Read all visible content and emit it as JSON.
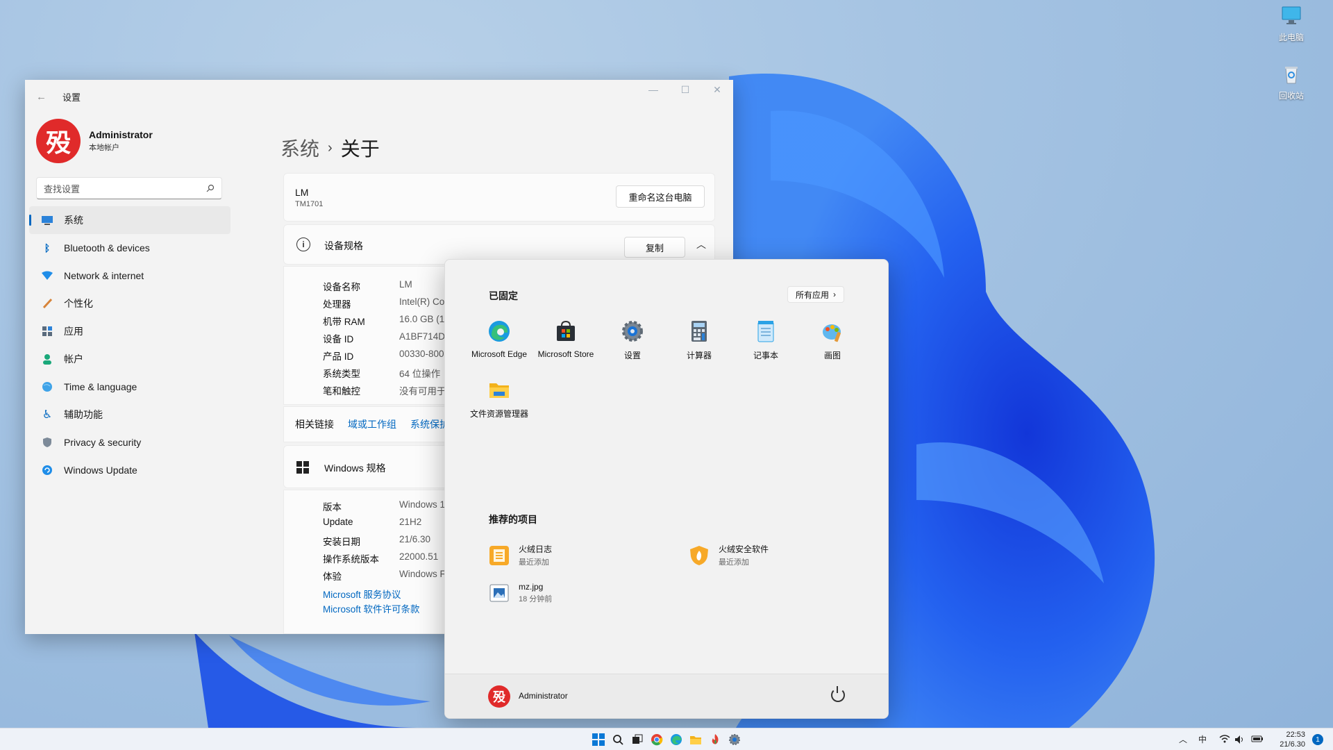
{
  "desktop": {
    "icons": [
      {
        "label": "此电脑",
        "icon": "monitor-icon"
      },
      {
        "label": "回收站",
        "icon": "recycle-bin-icon"
      }
    ]
  },
  "settings": {
    "title": "设置",
    "user": {
      "name": "Administrator",
      "type": "本地帐户",
      "avatar_char": "殁"
    },
    "search_placeholder": "查找设置",
    "nav": [
      {
        "label": "系统",
        "icon": "system-icon",
        "active": true
      },
      {
        "label": "Bluetooth & devices",
        "icon": "bluetooth-icon"
      },
      {
        "label": "Network & internet",
        "icon": "wifi-icon"
      },
      {
        "label": "个性化",
        "icon": "brush-icon"
      },
      {
        "label": "应用",
        "icon": "apps-icon"
      },
      {
        "label": "帐户",
        "icon": "person-icon"
      },
      {
        "label": "Time & language",
        "icon": "globe-icon"
      },
      {
        "label": "辅助功能",
        "icon": "accessibility-icon"
      },
      {
        "label": "Privacy & security",
        "icon": "shield-icon"
      },
      {
        "label": "Windows Update",
        "icon": "update-icon"
      }
    ],
    "breadcrumb": {
      "parent": "系统",
      "separator": "›",
      "current": "关于"
    },
    "pc": {
      "name": "LM",
      "model": "TM1701",
      "rename_label": "重命名这台电脑"
    },
    "device_spec": {
      "title": "设备规格",
      "copy_label": "复制",
      "rows": [
        {
          "label": "设备名称",
          "value": "LM"
        },
        {
          "label": "处理器",
          "value": "Intel(R) Co"
        },
        {
          "label": "机带 RAM",
          "value": "16.0 GB (15"
        },
        {
          "label": "设备 ID",
          "value": "A1BF714D-"
        },
        {
          "label": "产品 ID",
          "value": "00330-800"
        },
        {
          "label": "系统类型",
          "value": "64 位操作"
        },
        {
          "label": "笔和触控",
          "value": "没有可用于"
        }
      ]
    },
    "related": {
      "label": "相关链接",
      "links": [
        "域或工作组",
        "系统保护"
      ]
    },
    "windows_spec": {
      "title": "Windows 规格",
      "rows": [
        {
          "label": "版本",
          "value": "Windows 1"
        },
        {
          "label": "Update",
          "value": "21H2"
        },
        {
          "label": "安装日期",
          "value": "21/6.30"
        },
        {
          "label": "操作系统版本",
          "value": "22000.51"
        },
        {
          "label": "体验",
          "value": "Windows F"
        }
      ],
      "links": [
        "Microsoft 服务协议",
        "Microsoft 软件许可条款"
      ]
    }
  },
  "start_menu": {
    "pinned_title": "已固定",
    "all_apps_label": "所有应用",
    "pinned": [
      {
        "label": "Microsoft Edge",
        "icon": "edge-icon"
      },
      {
        "label": "Microsoft Store",
        "icon": "store-icon"
      },
      {
        "label": "设置",
        "icon": "settings-gear-icon"
      },
      {
        "label": "计算器",
        "icon": "calculator-icon"
      },
      {
        "label": "记事本",
        "icon": "notepad-icon"
      },
      {
        "label": "画图",
        "icon": "paint-icon"
      },
      {
        "label": "文件资源管理器",
        "icon": "folder-icon"
      }
    ],
    "recommended_title": "推荐的项目",
    "recommended": [
      {
        "title": "火绒日志",
        "sub": "最近添加",
        "icon": "log-icon"
      },
      {
        "title": "火绒安全软件",
        "sub": "最近添加",
        "icon": "huorong-shield-icon"
      },
      {
        "title": "mz.jpg",
        "sub": "18 分钟前",
        "icon": "image-file-icon"
      }
    ],
    "user": "Administrator"
  },
  "taskbar": {
    "tray_ime": "中",
    "time": "22:53",
    "date": "21/6.30",
    "notifications": "1"
  },
  "colors": {
    "accent": "#0067c0",
    "avatar": "#e02a2a"
  }
}
